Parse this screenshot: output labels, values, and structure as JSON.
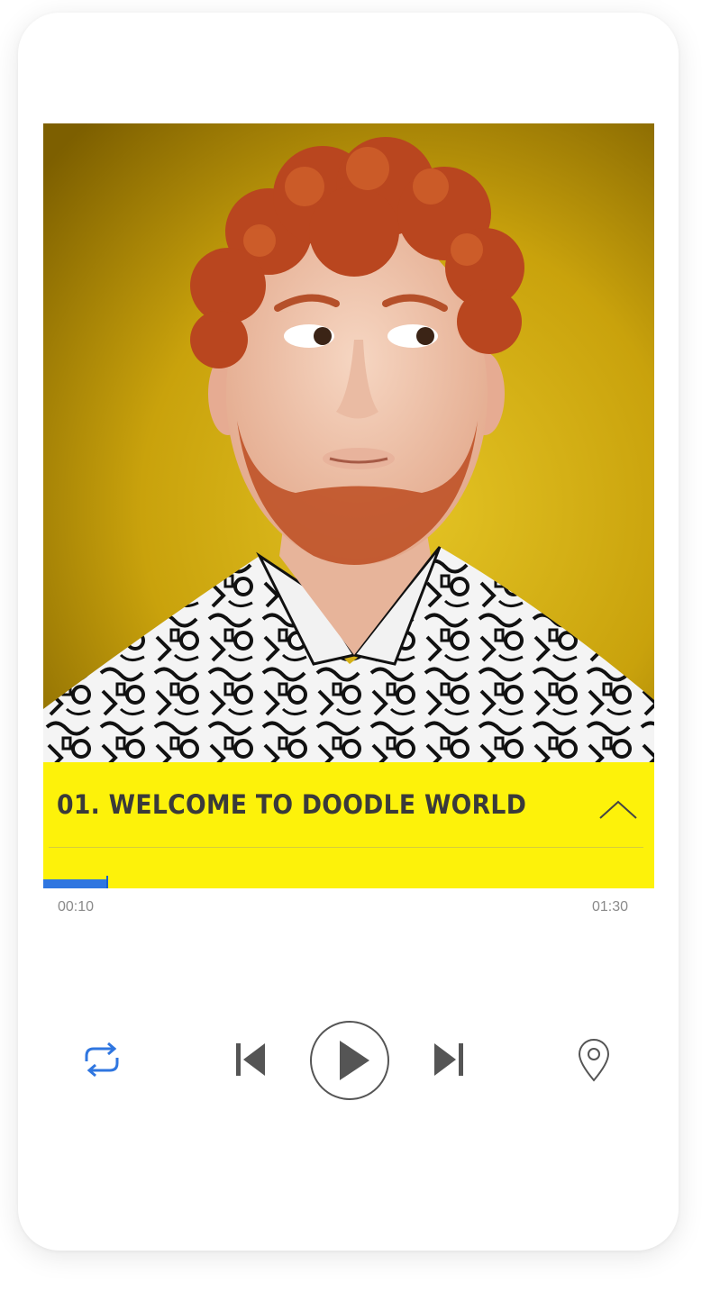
{
  "player": {
    "track_title": "01. WELCOME TO DOODLE WORLD",
    "progress": 0.105,
    "elapsed": "00:10",
    "total": "01:30"
  },
  "controls": {
    "repeat_icon": "repeat-icon",
    "previous_icon": "skip-previous-icon",
    "play_icon": "play-icon",
    "next_icon": "skip-next-icon",
    "location_icon": "location-pin-icon",
    "collapse_icon": "chevron-up-icon",
    "repeat_active": true
  },
  "colors": {
    "accent_blue": "#2f76e0",
    "title_bar_yellow": "#fdf20a",
    "artwork_background": "#caa40e",
    "title_text": "#3a3a3a",
    "icon_gray": "#555555"
  }
}
